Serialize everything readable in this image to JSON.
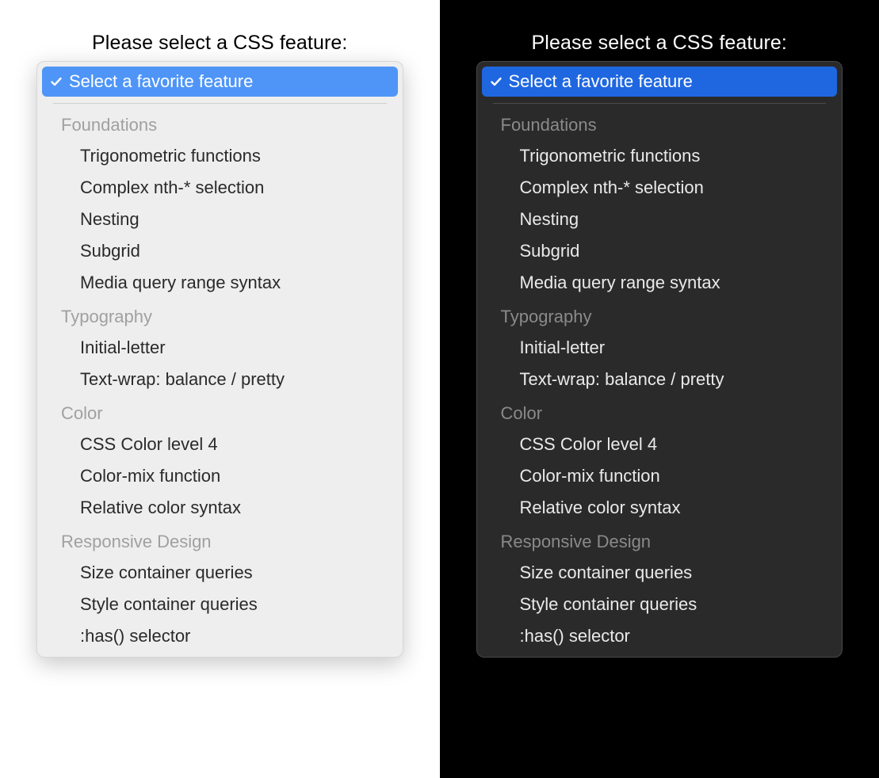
{
  "prompt": "Please select a CSS feature:",
  "colors": {
    "light_highlight": "#4f95f7",
    "dark_highlight": "#1f67e0"
  },
  "selected": {
    "label": "Select a favorite feature"
  },
  "groups": [
    {
      "title": "Foundations",
      "options": [
        "Trigonometric functions",
        "Complex nth-* selection",
        "Nesting",
        "Subgrid",
        "Media query range syntax"
      ]
    },
    {
      "title": "Typography",
      "options": [
        "Initial-letter",
        "Text-wrap: balance / pretty"
      ]
    },
    {
      "title": "Color",
      "options": [
        "CSS Color level 4",
        "Color-mix function",
        "Relative color syntax"
      ]
    },
    {
      "title": "Responsive Design",
      "options": [
        "Size container queries",
        "Style container queries",
        ":has() selector"
      ]
    }
  ]
}
